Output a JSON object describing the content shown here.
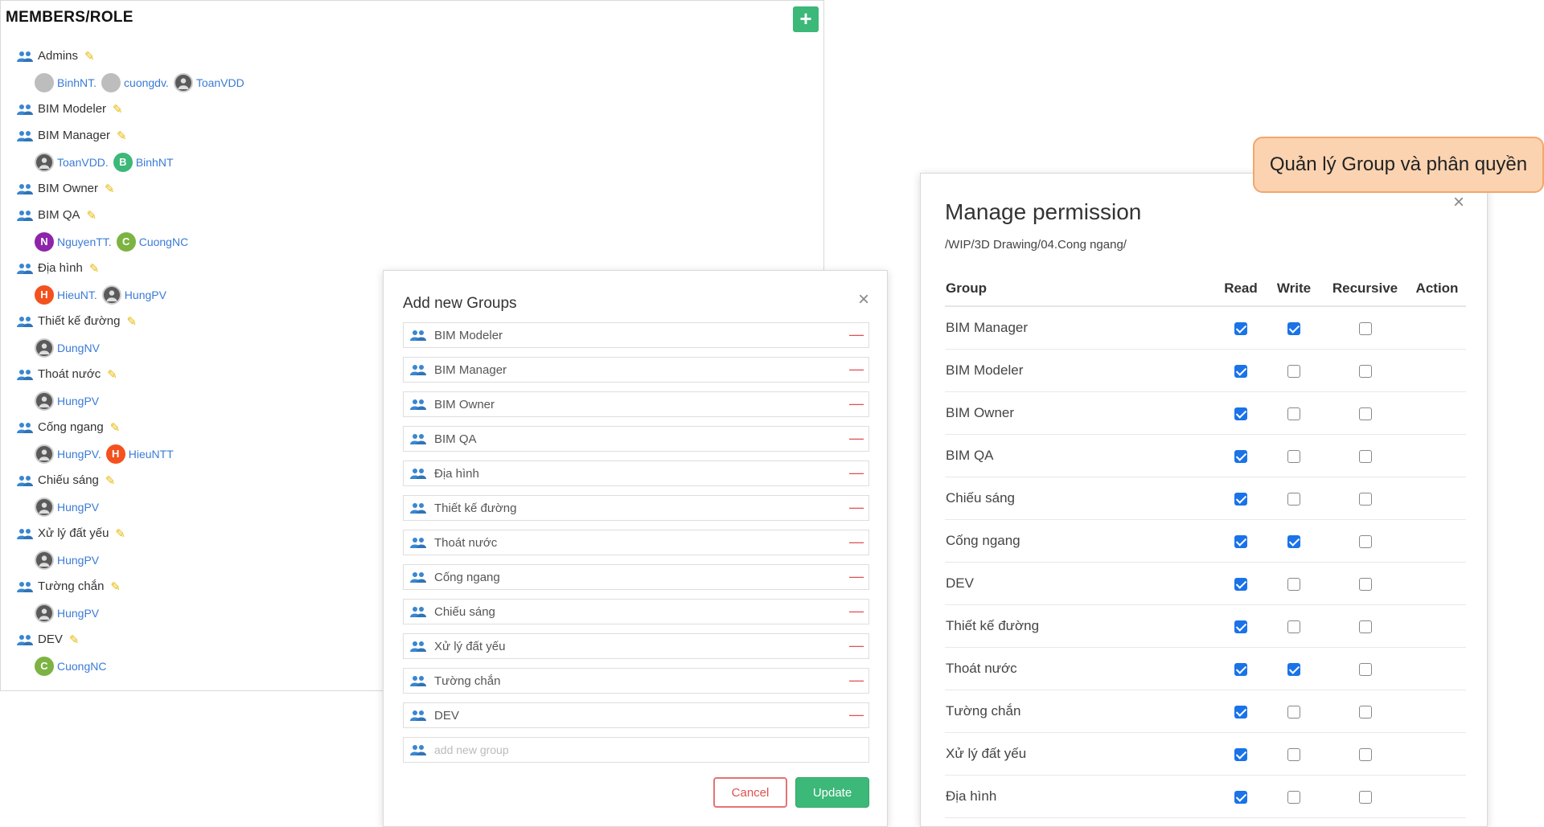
{
  "members": {
    "title": "MEMBERS/ROLE",
    "add_label": "+",
    "groups": [
      {
        "name": "Admins",
        "members": [
          {
            "name": "BinhNT.",
            "initial": "",
            "color": "#bdbdbd"
          },
          {
            "name": "cuongdv.",
            "initial": "",
            "color": "#bdbdbd"
          },
          {
            "name": "ToanVDD",
            "initial": "",
            "color": "photo"
          }
        ]
      },
      {
        "name": "BIM Modeler",
        "members": []
      },
      {
        "name": "BIM Manager",
        "members": [
          {
            "name": "ToanVDD.",
            "initial": "",
            "color": "photo"
          },
          {
            "name": "BinhNT",
            "initial": "B",
            "color": "#3cb878"
          }
        ]
      },
      {
        "name": "BIM Owner",
        "members": []
      },
      {
        "name": "BIM QA",
        "members": [
          {
            "name": "NguyenTT.",
            "initial": "N",
            "color": "#8e24aa"
          },
          {
            "name": "CuongNC",
            "initial": "C",
            "color": "#7cb342"
          }
        ]
      },
      {
        "name": "Địa hình",
        "members": [
          {
            "name": "HieuNT.",
            "initial": "H",
            "color": "#f4511e"
          },
          {
            "name": "HungPV",
            "initial": "",
            "color": "photo"
          }
        ]
      },
      {
        "name": "Thiết kế đường",
        "members": [
          {
            "name": "DungNV",
            "initial": "",
            "color": "photo"
          }
        ]
      },
      {
        "name": "Thoát nước",
        "members": [
          {
            "name": "HungPV",
            "initial": "",
            "color": "photo"
          }
        ]
      },
      {
        "name": "Cống ngang",
        "members": [
          {
            "name": "HungPV.",
            "initial": "",
            "color": "photo"
          },
          {
            "name": "HieuNTT",
            "initial": "H",
            "color": "#f4511e"
          }
        ]
      },
      {
        "name": "Chiếu sáng",
        "members": [
          {
            "name": "HungPV",
            "initial": "",
            "color": "photo"
          }
        ]
      },
      {
        "name": "Xử lý đất yếu",
        "members": [
          {
            "name": "HungPV",
            "initial": "",
            "color": "photo"
          }
        ]
      },
      {
        "name": "Tường chắn",
        "members": [
          {
            "name": "HungPV",
            "initial": "",
            "color": "photo"
          }
        ]
      },
      {
        "name": "DEV",
        "members": [
          {
            "name": "CuongNC",
            "initial": "C",
            "color": "#7cb342"
          }
        ]
      }
    ]
  },
  "add_groups": {
    "title": "Add new Groups",
    "close": "×",
    "items": [
      "BIM Modeler",
      "BIM Manager",
      "BIM Owner",
      "BIM QA",
      "Địa hình",
      "Thiết kế đường",
      "Thoát nước",
      "Cống ngang",
      "Chiếu sáng",
      "Xử lý đất yếu",
      "Tường chắn",
      "DEV"
    ],
    "new_placeholder": "add new group",
    "cancel_label": "Cancel",
    "update_label": "Update"
  },
  "permission": {
    "title": "Manage permission",
    "close": "×",
    "path": "/WIP/3D Drawing/04.Cong ngang/",
    "headers": {
      "group": "Group",
      "read": "Read",
      "write": "Write",
      "recursive": "Recursive",
      "action": "Action"
    },
    "rows": [
      {
        "group": "BIM Manager",
        "read": true,
        "write": true,
        "recursive": false
      },
      {
        "group": "BIM Modeler",
        "read": true,
        "write": false,
        "recursive": false
      },
      {
        "group": "BIM Owner",
        "read": true,
        "write": false,
        "recursive": false
      },
      {
        "group": "BIM QA",
        "read": true,
        "write": false,
        "recursive": false
      },
      {
        "group": "Chiếu sáng",
        "read": true,
        "write": false,
        "recursive": false
      },
      {
        "group": "Cống ngang",
        "read": true,
        "write": true,
        "recursive": false
      },
      {
        "group": "DEV",
        "read": true,
        "write": false,
        "recursive": false
      },
      {
        "group": "Thiết kế đường",
        "read": true,
        "write": false,
        "recursive": false
      },
      {
        "group": "Thoát nước",
        "read": true,
        "write": true,
        "recursive": false
      },
      {
        "group": "Tường chắn",
        "read": true,
        "write": false,
        "recursive": false
      },
      {
        "group": "Xử lý đất yếu",
        "read": true,
        "write": false,
        "recursive": false
      },
      {
        "group": "Địa hình",
        "read": true,
        "write": false,
        "recursive": false
      }
    ]
  },
  "callout": {
    "text": "Quản lý Group và phân quyền"
  },
  "colors": {
    "accent_green": "#3cb878",
    "link_blue": "#3a7bd5",
    "checkbox_blue": "#1a73e8",
    "remove_red": "#e05050"
  }
}
